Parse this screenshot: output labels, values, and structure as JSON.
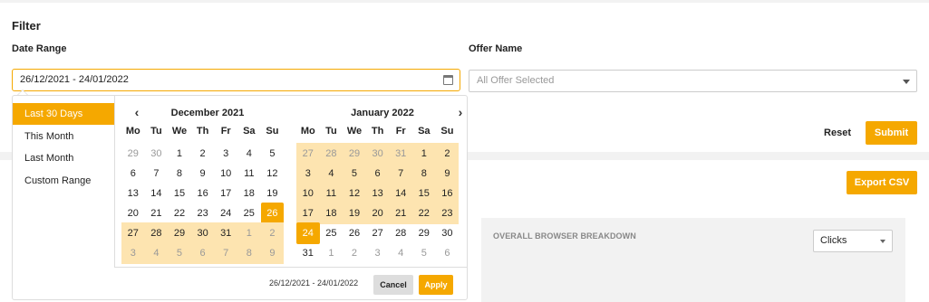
{
  "filter": {
    "title": "Filter",
    "date_range_label": "Date Range",
    "date_range_value": "26/12/2021 - 24/01/2022",
    "offer_name_label": "Offer Name",
    "offer_placeholder": "All Offer Selected",
    "reset_label": "Reset",
    "submit_label": "Submit"
  },
  "report": {
    "export_label": "Export CSV",
    "breakdown_title": "OVERALL BROWSER BREAKDOWN",
    "metric_selected": "Clicks"
  },
  "picker": {
    "ranges": [
      "Last 30 Days",
      "This Month",
      "Last Month",
      "Custom Range"
    ],
    "active_range": "Last 30 Days",
    "weekdays": [
      "Mo",
      "Tu",
      "We",
      "Th",
      "Fr",
      "Sa",
      "Su"
    ],
    "prev_icon": "chevron-left-icon",
    "next_icon": "chevron-right-icon",
    "left_month": {
      "title": "December 2021",
      "weeks": [
        [
          [
            "29",
            "off"
          ],
          [
            "30",
            "off"
          ],
          [
            "1",
            ""
          ],
          [
            "2",
            ""
          ],
          [
            "3",
            ""
          ],
          [
            "4",
            ""
          ],
          [
            "5",
            ""
          ]
        ],
        [
          [
            "6",
            ""
          ],
          [
            "7",
            ""
          ],
          [
            "8",
            ""
          ],
          [
            "9",
            ""
          ],
          [
            "10",
            ""
          ],
          [
            "11",
            ""
          ],
          [
            "12",
            ""
          ]
        ],
        [
          [
            "13",
            ""
          ],
          [
            "14",
            ""
          ],
          [
            "15",
            ""
          ],
          [
            "16",
            ""
          ],
          [
            "17",
            ""
          ],
          [
            "18",
            ""
          ],
          [
            "19",
            ""
          ]
        ],
        [
          [
            "20",
            ""
          ],
          [
            "21",
            ""
          ],
          [
            "22",
            ""
          ],
          [
            "23",
            ""
          ],
          [
            "24",
            ""
          ],
          [
            "25",
            ""
          ],
          [
            "26",
            "selected"
          ]
        ],
        [
          [
            "27",
            "inrange"
          ],
          [
            "28",
            "inrange"
          ],
          [
            "29",
            "inrange"
          ],
          [
            "30",
            "inrange"
          ],
          [
            "31",
            "inrange"
          ],
          [
            "1",
            "off inrange"
          ],
          [
            "2",
            "off inrange"
          ]
        ],
        [
          [
            "3",
            "off inrange"
          ],
          [
            "4",
            "off inrange"
          ],
          [
            "5",
            "off inrange"
          ],
          [
            "6",
            "off inrange"
          ],
          [
            "7",
            "off inrange"
          ],
          [
            "8",
            "off inrange"
          ],
          [
            "9",
            "off inrange"
          ]
        ]
      ]
    },
    "right_month": {
      "title": "January 2022",
      "weeks": [
        [
          [
            "27",
            "off inrange"
          ],
          [
            "28",
            "off inrange"
          ],
          [
            "29",
            "off inrange"
          ],
          [
            "30",
            "off inrange"
          ],
          [
            "31",
            "off inrange"
          ],
          [
            "1",
            "inrange"
          ],
          [
            "2",
            "inrange"
          ]
        ],
        [
          [
            "3",
            "inrange"
          ],
          [
            "4",
            "inrange"
          ],
          [
            "5",
            "inrange"
          ],
          [
            "6",
            "inrange"
          ],
          [
            "7",
            "inrange"
          ],
          [
            "8",
            "inrange"
          ],
          [
            "9",
            "inrange"
          ]
        ],
        [
          [
            "10",
            "inrange"
          ],
          [
            "11",
            "inrange"
          ],
          [
            "12",
            "inrange"
          ],
          [
            "13",
            "inrange"
          ],
          [
            "14",
            "inrange"
          ],
          [
            "15",
            "inrange"
          ],
          [
            "16",
            "inrange"
          ]
        ],
        [
          [
            "17",
            "inrange"
          ],
          [
            "18",
            "inrange"
          ],
          [
            "19",
            "inrange"
          ],
          [
            "20",
            "inrange"
          ],
          [
            "21",
            "inrange"
          ],
          [
            "22",
            "inrange"
          ],
          [
            "23",
            "inrange"
          ]
        ],
        [
          [
            "24",
            "selected"
          ],
          [
            "25",
            ""
          ],
          [
            "26",
            ""
          ],
          [
            "27",
            ""
          ],
          [
            "28",
            ""
          ],
          [
            "29",
            ""
          ],
          [
            "30",
            ""
          ]
        ],
        [
          [
            "31",
            ""
          ],
          [
            "1",
            "off"
          ],
          [
            "2",
            "off"
          ],
          [
            "3",
            "off"
          ],
          [
            "4",
            "off"
          ],
          [
            "5",
            "off"
          ],
          [
            "6",
            "off"
          ]
        ]
      ]
    },
    "footer_range": "26/12/2021 - 24/01/2022",
    "cancel_label": "Cancel",
    "apply_label": "Apply"
  },
  "colors": {
    "accent": "#f5a800",
    "range_fill": "#fde4b0"
  }
}
